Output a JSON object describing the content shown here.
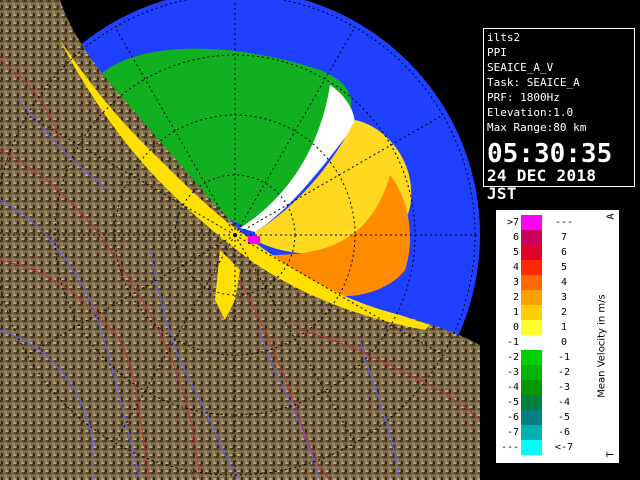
{
  "info": {
    "radar_name": "ilts2",
    "product": "PPI",
    "product_name": "SEAICE_A_V",
    "task": "Task: SEAICE_A",
    "prf": "PRF: 1800Hz",
    "elevation": "Elevation:1.0",
    "max_range": "Max Range:80 km",
    "time": "05:30:35",
    "date": "24 DEC 2018 JST"
  },
  "legend": {
    "title": "Mean Velocity in m/s",
    "corner_top": "A",
    "corner_bottom": "T",
    "rows": [
      {
        "left": ">7",
        "right": "---",
        "color": "#ff00ff"
      },
      {
        "left": "6",
        "right": "7",
        "color": "#c8005a"
      },
      {
        "left": "5",
        "right": "6",
        "color": "#e0002a"
      },
      {
        "left": "4",
        "right": "5",
        "color": "#ff2a00"
      },
      {
        "left": "3",
        "right": "4",
        "color": "#ff6a00"
      },
      {
        "left": "2",
        "right": "3",
        "color": "#ffa000"
      },
      {
        "left": "1",
        "right": "2",
        "color": "#ffd000"
      },
      {
        "left": "0",
        "right": "1",
        "color": "#ffff30"
      },
      {
        "left": "-1",
        "right": "0",
        "color": "#ffffff"
      },
      {
        "left": "-2",
        "right": "-1",
        "color": "#00d000"
      },
      {
        "left": "-3",
        "right": "-2",
        "color": "#00b400"
      },
      {
        "left": "-4",
        "right": "-3",
        "color": "#009800"
      },
      {
        "left": "-5",
        "right": "-4",
        "color": "#008040"
      },
      {
        "left": "-6",
        "right": "-5",
        "color": "#008080"
      },
      {
        "left": "-7",
        "right": "-6",
        "color": "#00b0b0"
      },
      {
        "left": "---",
        "right": "<-7",
        "color": "#00ffff"
      }
    ]
  },
  "colors": {
    "sea": "#2040ff",
    "land": "#7a6848",
    "land_dark": "#4a3a24",
    "range_ring": "#000000",
    "rivers": "#6060ff",
    "borders": "#c03030"
  }
}
